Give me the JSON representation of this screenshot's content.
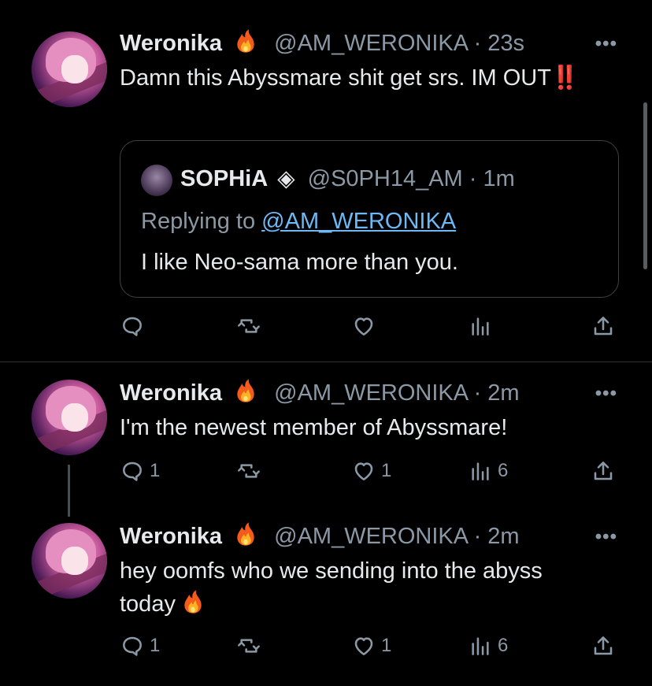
{
  "more_label": "•••",
  "tweets": [
    {
      "name": "Weronika",
      "handle": "@AM_WERONIKA",
      "time": "23s",
      "text": "Damn this Abyssmare shit get srs. IM OUT",
      "text_suffix": "‼️",
      "quote": {
        "name": "SOPHiA",
        "badge": "◈",
        "handle": "@S0PH14_AM",
        "time": "1m",
        "replying_prefix": "Replying to ",
        "replying_to": "@AM_WERONIKA",
        "text": "I like Neo-sama more than you."
      },
      "replies": "",
      "retweets": "",
      "likes": "",
      "views": ""
    },
    {
      "name": "Weronika",
      "handle": "@AM_WERONIKA",
      "time": "2m",
      "text": "I'm the newest member of Abyssmare!",
      "replies": "1",
      "retweets": "",
      "likes": "1",
      "views": "6"
    },
    {
      "name": "Weronika",
      "handle": "@AM_WERONIKA",
      "time": "2m",
      "text_line1": "hey oomfs who we sending into the abyss",
      "text_line2": "today",
      "replies": "1",
      "retweets": "",
      "likes": "1",
      "views": "6"
    }
  ],
  "colors": {
    "background": "#000000",
    "text": "#e7e9ea",
    "muted": "#8b98a5",
    "link": "#6db8f5",
    "alert": "#e0203b"
  },
  "icons": [
    "more-icon",
    "reply-icon",
    "retweet-icon",
    "like-icon",
    "views-icon",
    "share-icon",
    "fire-icon",
    "verified-diamond-icon"
  ]
}
